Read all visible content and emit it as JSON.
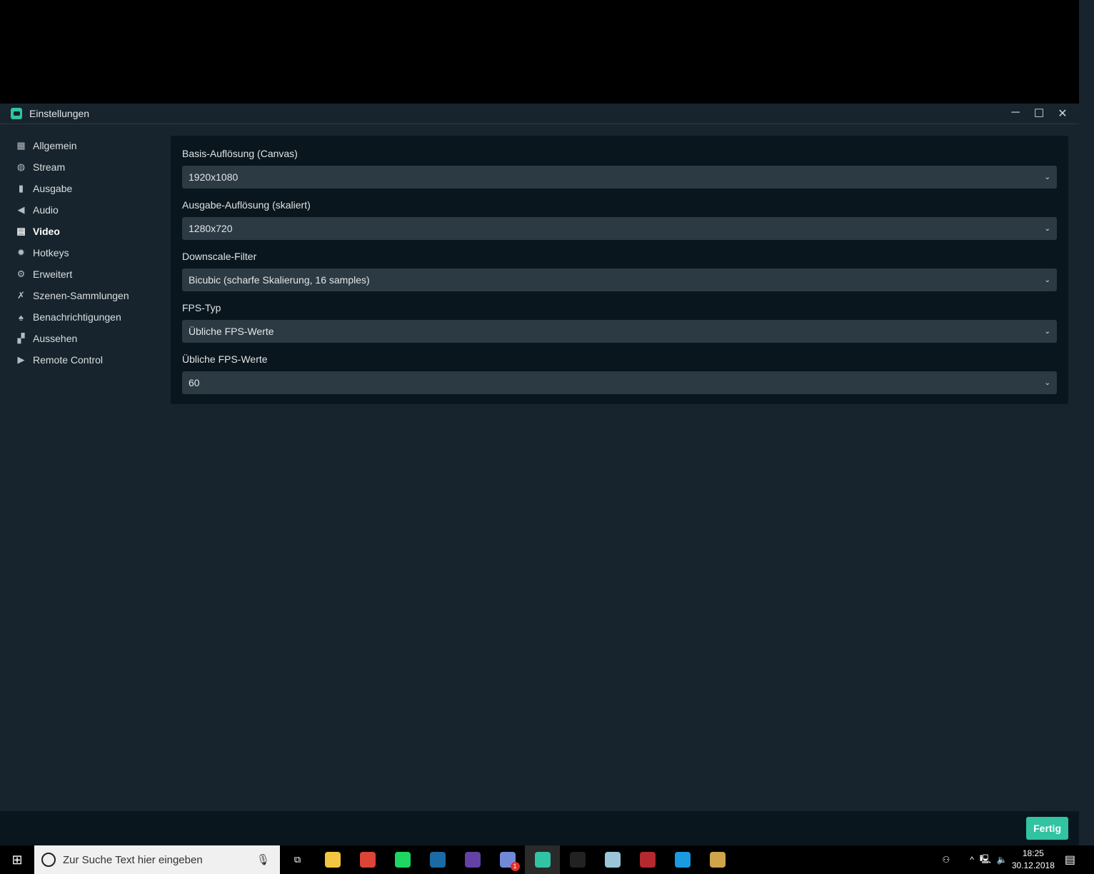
{
  "window": {
    "title": "Einstellungen",
    "minimize": "─",
    "maximize": "☐",
    "close": "✕"
  },
  "sidebar": {
    "items": [
      {
        "label": "Allgemein",
        "icon": "grid-icon",
        "glyph": "▦"
      },
      {
        "label": "Stream",
        "icon": "globe-icon",
        "glyph": "◍"
      },
      {
        "label": "Ausgabe",
        "icon": "chip-icon",
        "glyph": "▮"
      },
      {
        "label": "Audio",
        "icon": "speaker-icon",
        "glyph": "◀"
      },
      {
        "label": "Video",
        "icon": "film-icon",
        "glyph": "▤",
        "active": true
      },
      {
        "label": "Hotkeys",
        "icon": "gear-icon",
        "glyph": "✹"
      },
      {
        "label": "Erweitert",
        "icon": "gears-icon",
        "glyph": "⚙"
      },
      {
        "label": "Szenen-Sammlungen",
        "icon": "wand-icon",
        "glyph": "✗"
      },
      {
        "label": "Benachrichtigungen",
        "icon": "bell-icon",
        "glyph": "♠"
      },
      {
        "label": "Aussehen",
        "icon": "shapes-icon",
        "glyph": "▞"
      },
      {
        "label": "Remote Control",
        "icon": "play-circle-icon",
        "glyph": "▶"
      }
    ]
  },
  "settings": [
    {
      "label": "Basis-Auflösung (Canvas)",
      "value": "1920x1080"
    },
    {
      "label": "Ausgabe-Auflösung (skaliert)",
      "value": "1280x720"
    },
    {
      "label": "Downscale-Filter",
      "value": "Bicubic (scharfe Skalierung, 16 samples)"
    },
    {
      "label": "FPS-Typ",
      "value": "Übliche FPS-Werte"
    },
    {
      "label": "Übliche FPS-Werte",
      "value": "60"
    }
  ],
  "chevron": "⌄",
  "footer": {
    "done_label": "Fertig"
  },
  "accent": "#31c3a2",
  "taskbar": {
    "search_placeholder": "Zur Suche Text hier eingeben",
    "time": "18:25",
    "date": "30.12.2018",
    "apps": [
      {
        "name": "task-view",
        "color": "#000"
      },
      {
        "name": "file-explorer",
        "color": "#f4c542"
      },
      {
        "name": "chrome",
        "color": "#db4437"
      },
      {
        "name": "spotify",
        "color": "#1ed760"
      },
      {
        "name": "steam",
        "color": "#1b6aa5"
      },
      {
        "name": "twitch",
        "color": "#6441a4"
      },
      {
        "name": "discord",
        "color": "#7289da"
      },
      {
        "name": "streamlabs-obs",
        "color": "#31c3a2"
      },
      {
        "name": "epic-games",
        "color": "#222"
      },
      {
        "name": "notepad",
        "color": "#9bc6d8"
      },
      {
        "name": "winrar",
        "color": "#b4282f"
      },
      {
        "name": "fortnite",
        "color": "#1a9ae0"
      },
      {
        "name": "paint",
        "color": "#cfa44a"
      }
    ],
    "discord_badge": "1"
  }
}
